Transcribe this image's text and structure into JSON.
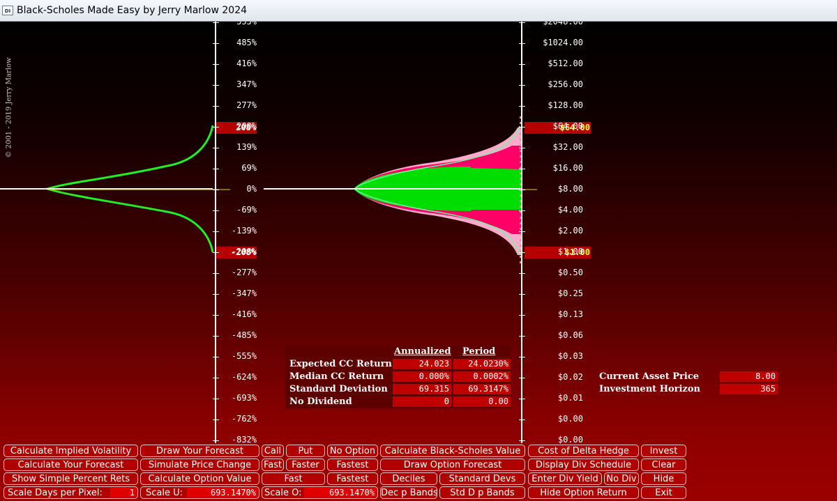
{
  "window": {
    "title": "Black-Scholes Made Easy by Jerry Marlow  2024",
    "icon": "DI"
  },
  "copyright": "© 2001 - 2019   Jerry Marlow",
  "left_axis": {
    "ticks": [
      "555%",
      "485%",
      "416%",
      "347%",
      "277%",
      "208%",
      "139%",
      "69%",
      "0%",
      "-69%",
      "-139%",
      "-208%",
      "-277%",
      "-347%",
      "-416%",
      "-485%",
      "-555%",
      "-624%",
      "-693%",
      "-762%",
      "-832%"
    ],
    "highlight_top": "208%",
    "highlight_bottom": "-208%"
  },
  "right_axis": {
    "ticks": [
      "$2048.00",
      "$1024.00",
      "$512.00",
      "$256.00",
      "$128.00",
      "$64.00",
      "$32.00",
      "$16.00",
      "$8.00",
      "$4.00",
      "$2.00",
      "$1.00",
      "$0.50",
      "$0.25",
      "$0.13",
      "$0.06",
      "$0.03",
      "$0.02",
      "$0.01",
      "$0.00",
      "$0.00"
    ],
    "highlight_top": "$64.00",
    "highlight_bottom": "$1.00"
  },
  "stats": {
    "headers": {
      "annualized": "Annualized",
      "period": "Period"
    },
    "rows": [
      {
        "label": "Expected CC Return",
        "annualized": "24.023",
        "period": "24.0230%"
      },
      {
        "label": "Median CC Return",
        "annualized": "0.000%",
        "period": "0.0002%"
      },
      {
        "label": "Standard Deviation",
        "annualized": "69.315",
        "period": "69.3147%"
      },
      {
        "label": "No Dividend",
        "annualized": "0",
        "period": "0.00"
      }
    ]
  },
  "asset": {
    "price_label": "Current Asset Price",
    "price_value": "8.00",
    "horizon_label": "Investment Horizon",
    "horizon_value": "365"
  },
  "buttons": {
    "calc_iv": "Calculate Implied Volatility",
    "draw_forecast": "Draw Your Forecast",
    "call": "Call",
    "put": "Put",
    "no_option": "No Option",
    "calc_bs": "Calculate Black-Scholes Value",
    "cost_delta": "Cost of Delta Hedge",
    "invest": "Invest",
    "calc_forecast": "Calculate Your Forecast",
    "simulate": "Simulate Price Change",
    "fast1": "Fast",
    "faster": "Faster",
    "fastest1": "Fastest",
    "draw_option": "Draw Option Forecast",
    "div_schedule": "Display Div Schedule",
    "clear": "Clear",
    "show_simple": "Show Simple Percent Rets",
    "calc_option": "Calculate Option  Value",
    "fast2": "Fast",
    "fastest2": "Fastest",
    "deciles": "Deciles",
    "std_devs": "Standard Devs",
    "enter_div": "Enter Div Yield",
    "no_div": "No Div",
    "hide": "Hide",
    "scale_days_label": "Scale Days per Pixel:",
    "scale_days_value": "1",
    "scale_u_label": "Scale U:",
    "scale_u_value": "693.1470%",
    "scale_o_label": "Scale O:",
    "scale_o_value": "693.1470%",
    "dec_bands": "Dec p Bands",
    "std_bands": "Std D p Bands",
    "hide_return": "Hide Option Return",
    "exit": "Exit"
  },
  "colors": {
    "curve": "#22ee22",
    "fill": "#00dd00",
    "band_pink": "#ff0066",
    "band_light": "#ffaacc",
    "highlight": "#b40000",
    "highlight_text": "#ffff44"
  }
}
